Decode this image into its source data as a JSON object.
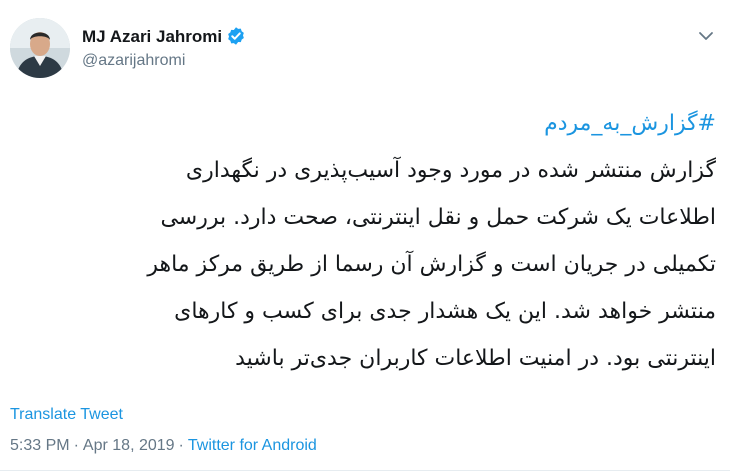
{
  "author": {
    "display_name": "MJ Azari Jahromi",
    "handle": "@azarijahromi",
    "verified": true
  },
  "tweet": {
    "hashtag": "#گزارش_به_مردم",
    "lines": [
      "گزارش منتشر شده در مورد وجود آسیب‌پذیری در نگهداری",
      "اطلاعات یک شرکت حمل و نقل اینترنتی، صحت دارد. بررسی",
      "تکمیلی در جریان است و گزارش آن رسما از طریق مرکز ماهر",
      "منتشر خواهد شد. این یک هشدار جدی برای کسب و کارهای",
      "اینترنتی بود. در امنیت اطلاعات کاربران جدی‌تر باشید"
    ]
  },
  "actions": {
    "translate_label": "Translate Tweet"
  },
  "meta": {
    "time": "5:33 PM",
    "separator": "·",
    "date": "Apr 18, 2019",
    "source": "Twitter for Android"
  },
  "colors": {
    "link": "#1b95e0",
    "text": "#14171a",
    "muted": "#657786",
    "verified": "#1da1f2"
  }
}
